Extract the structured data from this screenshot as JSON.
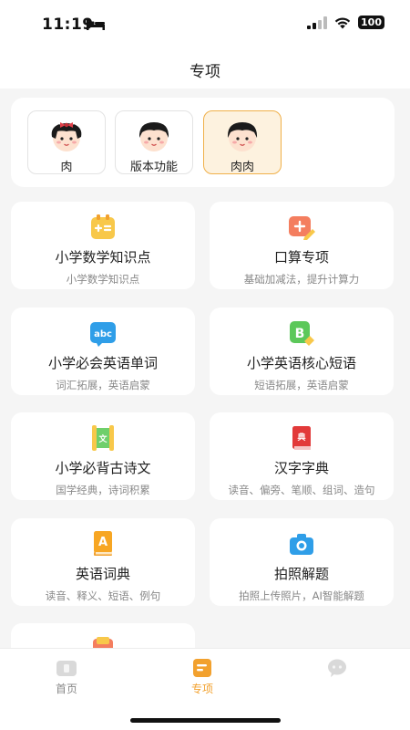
{
  "status_bar": {
    "time": "11:19",
    "battery": "100"
  },
  "nav": {
    "title": "专项"
  },
  "profiles": [
    {
      "name": "肉",
      "selected": false
    },
    {
      "name": "版本功能",
      "selected": false
    },
    {
      "name": "肉肉",
      "selected": true
    }
  ],
  "features": [
    {
      "title": "小学数学知识点",
      "subtitle": "小学数学知识点",
      "icon": "math-calculator-icon"
    },
    {
      "title": "口算专项",
      "subtitle": "基础加减法，提升计算力",
      "icon": "mental-arithmetic-icon"
    },
    {
      "title": "小学必会英语单词",
      "subtitle": "词汇拓展，英语启蒙",
      "icon": "abc-icon",
      "icon_text": "abc"
    },
    {
      "title": "小学英语核心短语",
      "subtitle": "短语拓展，英语启蒙",
      "icon": "phrase-b-icon",
      "icon_text": "B"
    },
    {
      "title": "小学必背古诗文",
      "subtitle": "国学经典，诗词积累",
      "icon": "scroll-icon",
      "icon_text": "文"
    },
    {
      "title": "汉字字典",
      "subtitle": "读音、偏旁、笔顺、组词、造句",
      "icon": "dictionary-icon",
      "icon_text": "典"
    },
    {
      "title": "英语词典",
      "subtitle": "读音、释义、短语、例句",
      "icon": "english-dictionary-icon",
      "icon_text": "A"
    },
    {
      "title": "拍照解题",
      "subtitle": "拍照上传照片，AI智能解题",
      "icon": "camera-icon"
    }
  ],
  "tabs": [
    {
      "label": "首页",
      "icon": "home-tv-icon",
      "active": false
    },
    {
      "label": "专项",
      "icon": "special-topic-icon",
      "active": true
    },
    {
      "label": "",
      "icon": "chat-bubble-icon",
      "active": false
    }
  ],
  "colors": {
    "accent": "#f2a12e",
    "selected_profile_bg": "#fdf2df",
    "background": "#f5f5f5"
  }
}
